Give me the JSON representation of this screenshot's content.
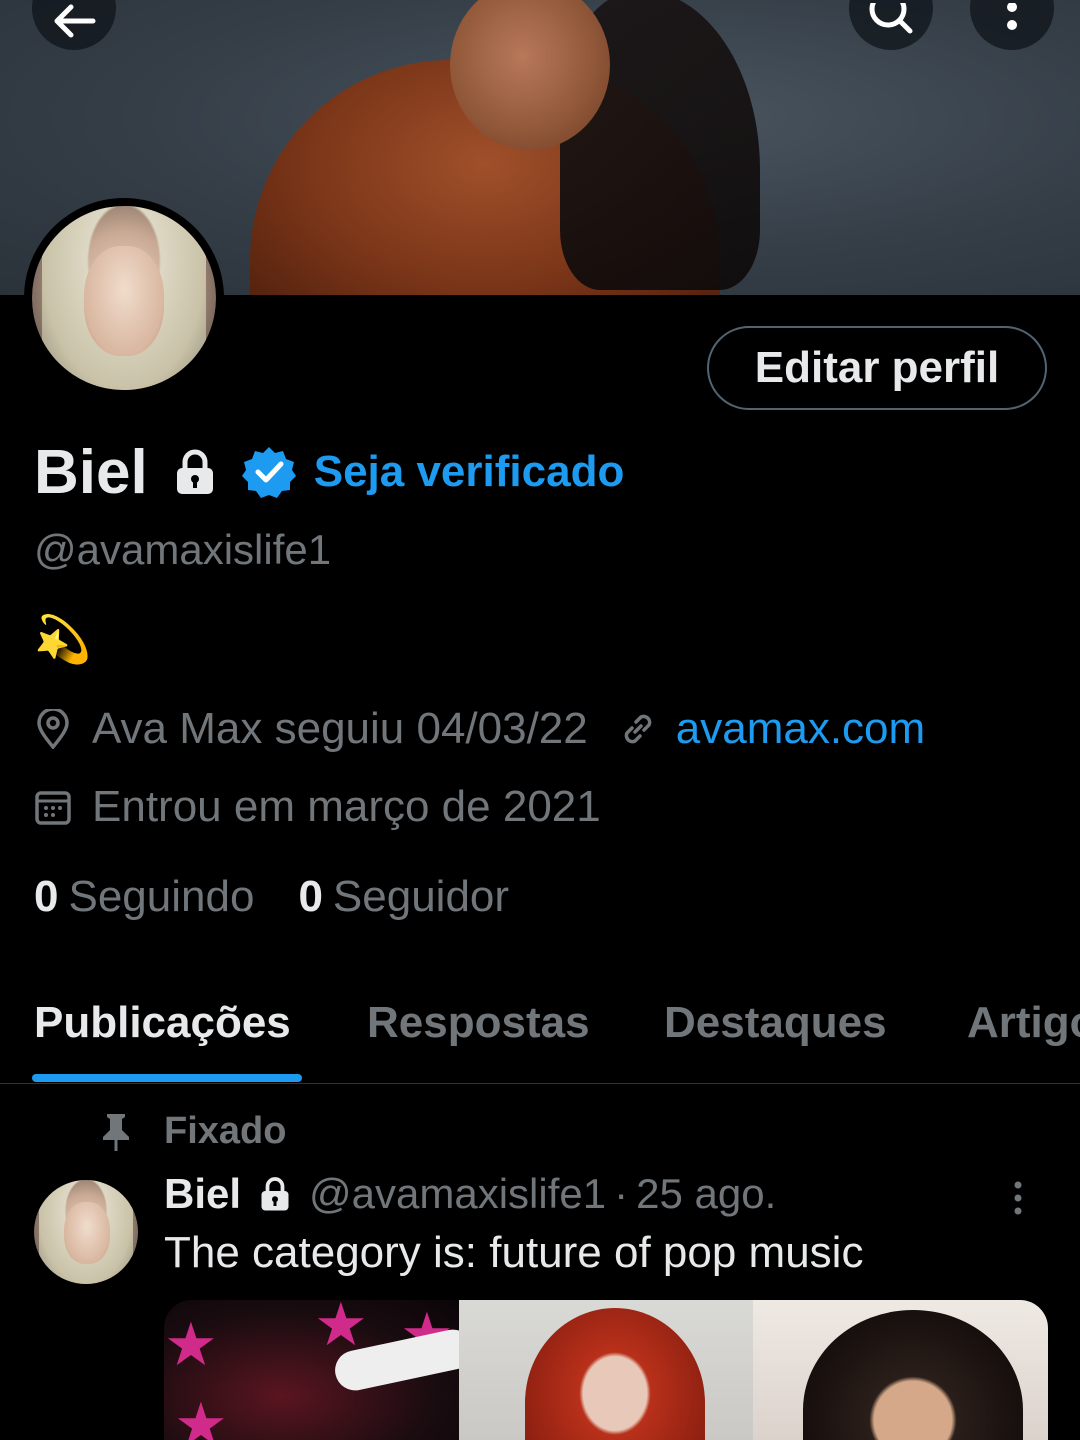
{
  "header": {
    "back_icon": "arrow-left-icon",
    "search_icon": "search-icon",
    "more_icon": "more-vertical-icon"
  },
  "profile": {
    "edit_label": "Editar perfil",
    "display_name": "Biel",
    "verify_label": "Seja verificado",
    "handle": "@avamaxislife1",
    "bio": "💫",
    "location": "Ava Max seguiu 04/03/22",
    "website": "avamax.com",
    "joined": "Entrou em março de 2021",
    "following_count": "0",
    "following_label": "Seguindo",
    "followers_count": "0",
    "followers_label": "Seguidor"
  },
  "tabs": [
    {
      "label": "Publicações",
      "active": true
    },
    {
      "label": "Respostas",
      "active": false
    },
    {
      "label": "Destaques",
      "active": false
    },
    {
      "label": "Artigos",
      "active": false
    }
  ],
  "pinned_post": {
    "pinned_label": "Fixado",
    "author_name": "Biel",
    "author_handle": "@avamaxislife1",
    "separator": "·",
    "date": "25 ago.",
    "text": "The category is: future of pop music"
  },
  "colors": {
    "accent": "#1d9bf0",
    "background": "#000000",
    "text_primary": "#e7e9ea",
    "text_secondary": "#71767b"
  }
}
